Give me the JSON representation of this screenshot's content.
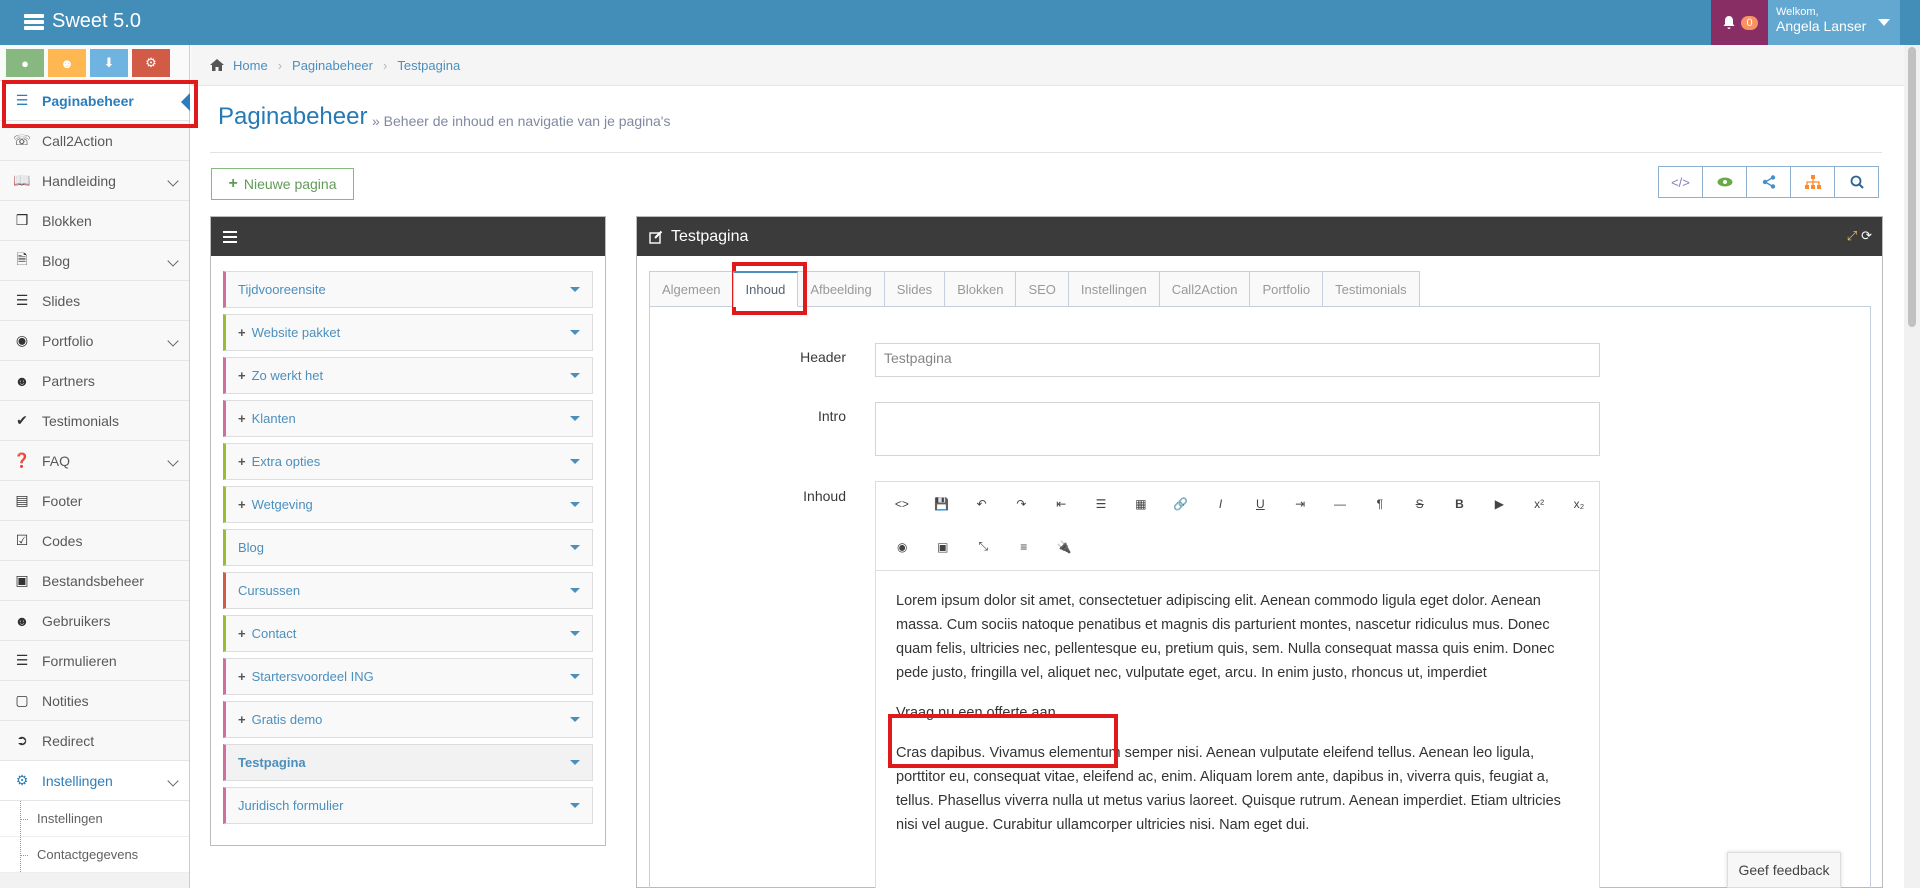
{
  "app": {
    "title": "Sweet 5.0"
  },
  "user": {
    "welcome": "Welkom,",
    "name": "Angela Lanser",
    "notifications": "0"
  },
  "colors": {
    "topbar": "#438eb9",
    "accent": "#2b7dbc",
    "notif": "#892e65",
    "highlight": "#e01a1a"
  },
  "shortcuts": [
    {
      "icon": "map-marker-icon",
      "color": "#87b87f"
    },
    {
      "icon": "user-icon",
      "color": "#ffb752"
    },
    {
      "icon": "download-icon",
      "color": "#6fb3e0"
    },
    {
      "icon": "cogs-icon",
      "color": "#d15b47"
    }
  ],
  "sidebar": {
    "items": [
      {
        "label": "Paginabeheer",
        "icon": "bars-icon"
      },
      {
        "label": "Call2Action",
        "icon": "phone-icon"
      },
      {
        "label": "Handleiding",
        "icon": "book-icon"
      },
      {
        "label": "Blokken",
        "icon": "cubes-icon"
      },
      {
        "label": "Blog",
        "icon": "file-icon"
      },
      {
        "label": "Slides",
        "icon": "sliders-icon"
      },
      {
        "label": "Portfolio",
        "icon": "camera-icon"
      },
      {
        "label": "Partners",
        "icon": "users-icon"
      },
      {
        "label": "Testimonials",
        "icon": "check-icon"
      },
      {
        "label": "FAQ",
        "icon": "question-icon"
      },
      {
        "label": "Footer",
        "icon": "list-alt-icon"
      },
      {
        "label": "Codes",
        "icon": "check-square-icon"
      },
      {
        "label": "Bestandsbeheer",
        "icon": "picture-icon"
      },
      {
        "label": "Gebruikers",
        "icon": "user-icon"
      },
      {
        "label": "Formulieren",
        "icon": "list-icon"
      },
      {
        "label": "Notities",
        "icon": "note-icon"
      },
      {
        "label": "Redirect",
        "icon": "arrow-circle-icon"
      },
      {
        "label": "Instellingen",
        "icon": "cog-icon"
      }
    ],
    "subitems": [
      {
        "label": "Instellingen"
      },
      {
        "label": "Contactgegevens"
      }
    ]
  },
  "breadcrumb": {
    "home": "Home",
    "section": "Paginabeheer",
    "page": "Testpagina"
  },
  "header": {
    "title": "Paginabeheer",
    "subtitle": "» Beheer de inhoud en navigatie van je pagina's"
  },
  "actions": {
    "new_page": "Nieuwe pagina"
  },
  "toolbar_right": [
    "code-icon",
    "eye-icon",
    "share-icon",
    "sitemap-icon",
    "search-icon"
  ],
  "tree": {
    "items": [
      {
        "label": "Tijdvooreensite",
        "plus": false,
        "color": "pink"
      },
      {
        "label": "Website pakket",
        "plus": true,
        "color": "green"
      },
      {
        "label": "Zo werkt het",
        "plus": true,
        "color": "pink"
      },
      {
        "label": "Klanten",
        "plus": true,
        "color": "pink"
      },
      {
        "label": "Extra opties",
        "plus": true,
        "color": "green"
      },
      {
        "label": "Wetgeving",
        "plus": true,
        "color": "green"
      },
      {
        "label": "Blog",
        "plus": false,
        "color": "green"
      },
      {
        "label": "Cursussen",
        "plus": false,
        "color": "red"
      },
      {
        "label": "Contact",
        "plus": true,
        "color": "green"
      },
      {
        "label": "Startersvoordeel ING",
        "plus": true,
        "color": "pink"
      },
      {
        "label": "Gratis demo",
        "plus": true,
        "color": "pink"
      },
      {
        "label": "Testpagina",
        "plus": false,
        "color": "pink"
      },
      {
        "label": "Juridisch formulier",
        "plus": false,
        "color": "pink"
      }
    ]
  },
  "panel": {
    "title": "Testpagina",
    "tabs": [
      "Algemeen",
      "Inhoud",
      "Afbeelding",
      "Slides",
      "Blokken",
      "SEO",
      "Instellingen",
      "Call2Action",
      "Portfolio",
      "Testimonials"
    ],
    "active_tab": "Inhoud"
  },
  "form": {
    "header_label": "Header",
    "header_value": "Testpagina",
    "intro_label": "Intro",
    "intro_value": "",
    "inhoud_label": "Inhoud"
  },
  "editor": {
    "toolbar_row1": [
      "code-icon",
      "save-icon",
      "undo-icon",
      "redo-icon",
      "outdent-icon",
      "list-ul-icon",
      "table-icon",
      "link-icon",
      "italic-icon",
      "underline-icon",
      "indent-icon",
      "hr-icon",
      "paragraph-icon",
      "strikethrough-icon",
      "bold-icon",
      "video-icon",
      "superscript-icon",
      "subscript-icon"
    ],
    "toolbar_row2": [
      "circle-icon",
      "image-icon",
      "fullscreen-icon",
      "align-icon",
      "plugin-icon"
    ],
    "paragraph1": "Lorem ipsum dolor sit amet, consectetuer adipiscing elit. Aenean commodo ligula eget dolor. Aenean massa. Cum sociis natoque penatibus et magnis dis parturient montes, nascetur ridiculus mus. Donec quam felis, ultricies nec, pellentesque eu, pretium quis, sem. Nulla consequat massa quis enim. Donec pede justo, fringilla vel, aliquet nec, vulputate eget, arcu. In enim justo, rhoncus ut, imperdiet",
    "paragraph2": "Vraag nu een offerte aan",
    "paragraph3": "Cras dapibus. Vivamus elementum semper nisi. Aenean vulputate eleifend tellus. Aenean leo ligula, porttitor eu, consequat vitae, eleifend ac, enim. Aliquam lorem ante, dapibus in, viverra quis, feugiat a, tellus. Phasellus viverra nulla ut metus varius laoreet. Quisque rutrum. Aenean imperdiet. Etiam ultricies nisi vel augue. Curabitur ullamcorper ultricies nisi. Nam eget dui."
  },
  "feedback": {
    "label": "Geef feedback"
  }
}
